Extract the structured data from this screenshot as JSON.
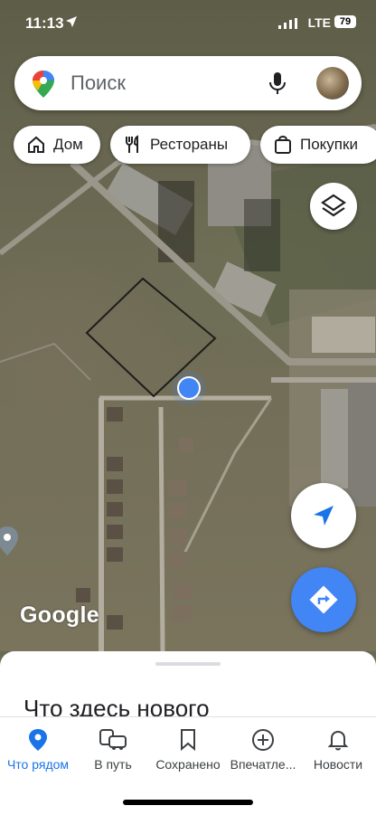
{
  "status": {
    "time": "11:13",
    "network": "LTE",
    "battery": "79"
  },
  "search": {
    "placeholder": "Поиск"
  },
  "chips": [
    {
      "label": "Дом",
      "icon": "home-icon"
    },
    {
      "label": "Рестораны",
      "icon": "restaurant-icon"
    },
    {
      "label": "Покупки",
      "icon": "shopping-bag-icon"
    }
  ],
  "map": {
    "logo": "Google",
    "accent": "#4285f4"
  },
  "sheet": {
    "title": "Что здесь нового"
  },
  "nav": [
    {
      "label": "Что рядом",
      "icon": "location-pin-icon",
      "active": true
    },
    {
      "label": "В путь",
      "icon": "commute-icon",
      "active": false
    },
    {
      "label": "Сохранено",
      "icon": "bookmark-icon",
      "active": false
    },
    {
      "label": "Впечатле...",
      "icon": "add-circle-icon",
      "active": false
    },
    {
      "label": "Новости",
      "icon": "bell-icon",
      "active": false
    }
  ]
}
